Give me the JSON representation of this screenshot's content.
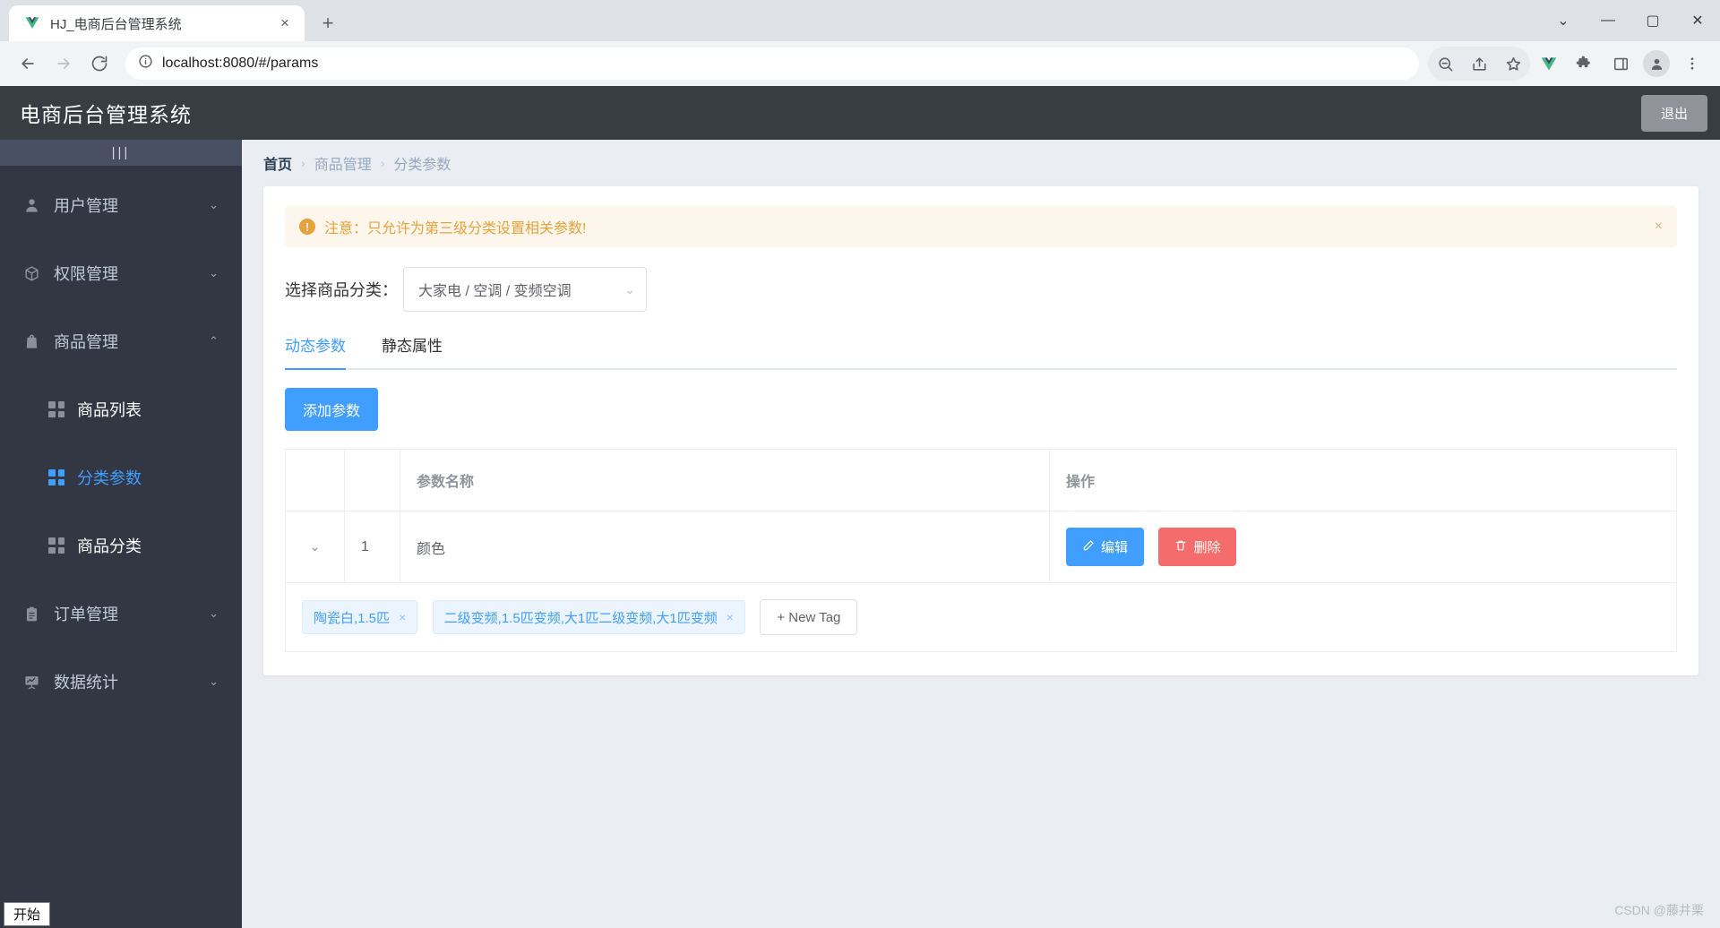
{
  "browser": {
    "tab": {
      "title": "HJ_电商后台管理系统",
      "favicon": "vue-logo-icon",
      "close": "×"
    },
    "new_tab": "+",
    "window_controls": {
      "minimize": "—",
      "maximize": "▢",
      "close": "✕",
      "list": "⌄"
    },
    "nav": {
      "back": "←",
      "forward": "→",
      "reload": "⟳"
    },
    "omnibox": {
      "url": "localhost:8080/#/params",
      "site_info_icon": "info-circle-icon"
    },
    "toolbar_icons": [
      "zoom-out-icon",
      "share-icon",
      "bookmark-star-icon",
      "vue-devtools-icon",
      "extensions-puzzle-icon",
      "side-panel-icon",
      "profile-avatar-icon",
      "chrome-menu-icon"
    ]
  },
  "app": {
    "header": {
      "title": "电商后台管理系统",
      "logout_label": "退出"
    },
    "sidebar": {
      "collapse_toggle": "|||",
      "items": [
        {
          "label": "用户管理",
          "icon": "user-icon",
          "arrow": "⌄",
          "expanded": false
        },
        {
          "label": "权限管理",
          "icon": "box-icon",
          "arrow": "⌄",
          "expanded": false
        },
        {
          "label": "商品管理",
          "icon": "bag-icon",
          "arrow": "⌃",
          "expanded": true,
          "children": [
            {
              "label": "商品列表",
              "icon": "grid-icon",
              "active": false
            },
            {
              "label": "分类参数",
              "icon": "grid-icon",
              "active": true
            },
            {
              "label": "商品分类",
              "icon": "grid-icon",
              "active": false
            }
          ]
        },
        {
          "label": "订单管理",
          "icon": "clipboard-icon",
          "arrow": "⌄",
          "expanded": false
        },
        {
          "label": "数据统计",
          "icon": "chart-board-icon",
          "arrow": "⌄",
          "expanded": false
        }
      ]
    },
    "breadcrumb": {
      "items": [
        "首页",
        "商品管理",
        "分类参数"
      ],
      "separator": "›"
    },
    "alert": {
      "icon": "!",
      "text": "注意：只允许为第三级分类设置相关参数!",
      "close": "×"
    },
    "category_select": {
      "label": "选择商品分类：",
      "value": "大家电 / 空调 / 变频空调",
      "arrow": "⌄"
    },
    "tabs": [
      {
        "label": "动态参数",
        "active": true
      },
      {
        "label": "静态属性",
        "active": false
      }
    ],
    "add_button": "添加参数",
    "table": {
      "headers": [
        "",
        "",
        "参数名称",
        "操作"
      ],
      "rows": [
        {
          "expand_icon": "⌄",
          "index": "1",
          "name": "颜色",
          "edit_label": "编辑",
          "edit_icon": "pencil-icon",
          "delete_label": "删除",
          "delete_icon": "trash-icon",
          "tags": [
            "陶瓷白,1.5匹",
            "二级变频,1.5匹变频,大1匹二级变频,大1匹变频"
          ],
          "tag_close": "×",
          "new_tag_label": "+ New Tag"
        }
      ]
    },
    "colors": {
      "primary": "#409eff",
      "danger": "#f56c6c",
      "warning": "#e6a23c",
      "header_bg": "#373d41",
      "sidebar_bg": "#333744",
      "content_bg": "#eaedf1"
    }
  },
  "desktop": {
    "start_button": "开始",
    "watermark": "CSDN @藤井栗"
  }
}
